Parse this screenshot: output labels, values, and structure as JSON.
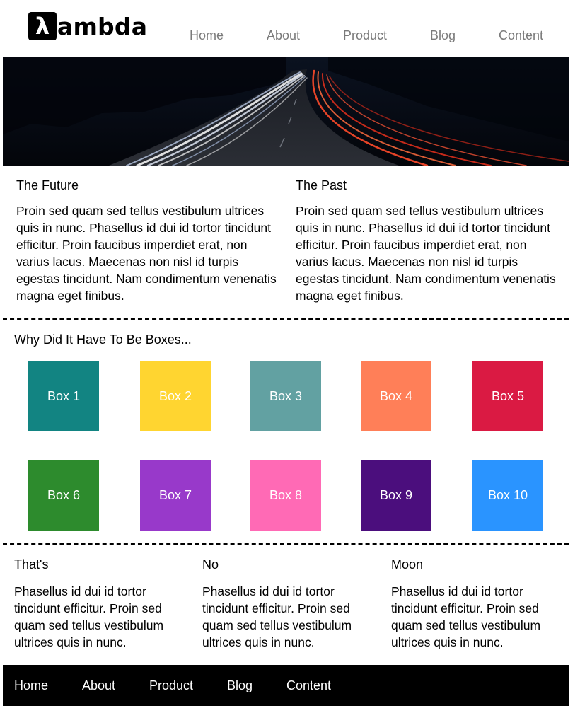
{
  "header": {
    "logo_mark": "λ",
    "logo_text": "ambda",
    "nav": [
      "Home",
      "About",
      "Product",
      "Blog",
      "Content"
    ]
  },
  "hero": {
    "image": "highway-light-trails-night"
  },
  "top_columns": [
    {
      "title": "The Future",
      "text": "Proin sed quam sed tellus vestibulum ultrices quis in nunc. Phasellus id dui id tortor tincidunt efficitur. Proin faucibus imperdiet erat, non varius lacus. Maecenas non nisl id turpis egestas tincidunt. Nam condimentum venenatis magna eget finibus."
    },
    {
      "title": "The Past",
      "text": "Proin sed quam sed tellus vestibulum ultrices quis in nunc. Phasellus id dui id tortor tincidunt efficitur. Proin faucibus imperdiet erat, non varius lacus. Maecenas non nisl id turpis egestas tincidunt. Nam condimentum venenatis magna eget finibus."
    }
  ],
  "boxes_section": {
    "title": "Why Did It Have To Be Boxes...",
    "boxes": [
      {
        "label": "Box 1",
        "color": "#128482"
      },
      {
        "label": "Box 2",
        "color": "#FFD530"
      },
      {
        "label": "Box 3",
        "color": "#62A1A2"
      },
      {
        "label": "Box 4",
        "color": "#FF7F58"
      },
      {
        "label": "Box 5",
        "color": "#DA1A43"
      },
      {
        "label": "Box 6",
        "color": "#2D8B2D"
      },
      {
        "label": "Box 7",
        "color": "#9839CA"
      },
      {
        "label": "Box 8",
        "color": "#FF6AB5"
      },
      {
        "label": "Box 9",
        "color": "#4B0E7D"
      },
      {
        "label": "Box 10",
        "color": "#2A94FF"
      }
    ]
  },
  "bottom_columns": [
    {
      "title": "That's",
      "text": "Phasellus id dui id tortor tincidunt efficitur. Proin sed quam sed tellus vestibulum ultrices quis in nunc."
    },
    {
      "title": "No",
      "text": "Phasellus id dui id tortor tincidunt efficitur. Proin sed quam sed tellus vestibulum ultrices quis in nunc."
    },
    {
      "title": "Moon",
      "text": "Phasellus id dui id tortor tincidunt efficitur. Proin sed quam sed tellus vestibulum ultrices quis in nunc."
    }
  ],
  "footer": {
    "nav": [
      "Home",
      "About",
      "Product",
      "Blog",
      "Content"
    ]
  }
}
